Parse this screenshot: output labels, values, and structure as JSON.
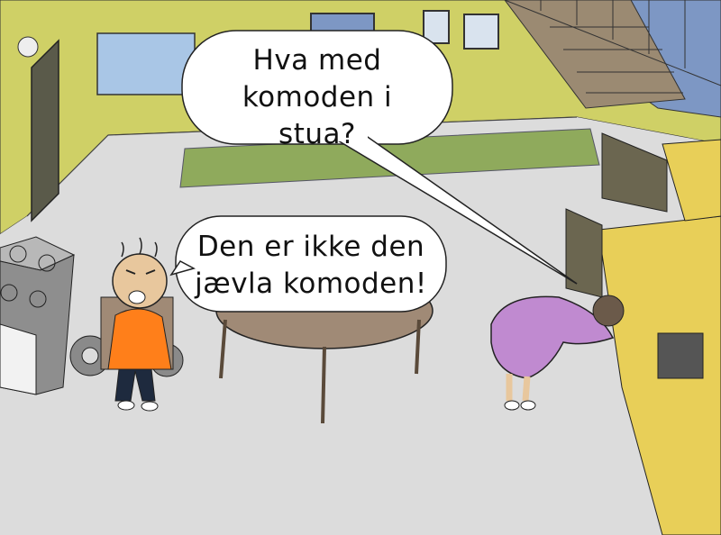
{
  "speech_bubbles": [
    {
      "line1": "Hva med",
      "line2": "komoden i stua?"
    },
    {
      "line1": "Den er ikke den",
      "line2": "jævla komoden!"
    }
  ],
  "colors": {
    "wall": "#cfd066",
    "floor": "#dcdcdc",
    "stair_wall": "#7d97c4",
    "rug": "#8faa5c",
    "table": "#a08a76",
    "dresser": "#e8cf58",
    "shirt": "#ff7f1a",
    "dress": "#c08ad0",
    "bubble_fill": "#ffffff",
    "outline": "#222222"
  }
}
